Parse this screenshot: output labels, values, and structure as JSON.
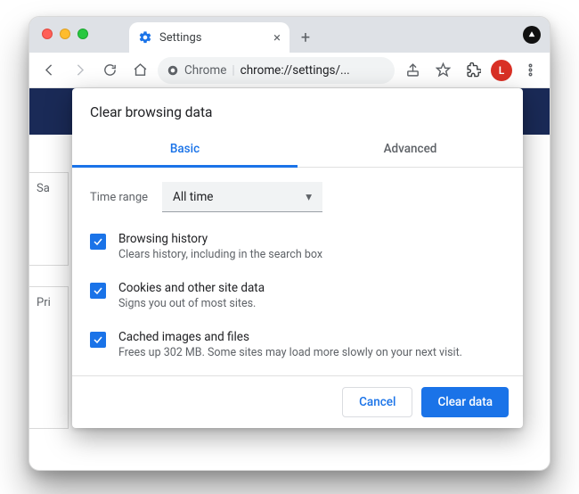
{
  "tab": {
    "title": "Settings"
  },
  "omnibox": {
    "label": "Chrome",
    "url": "chrome://settings/..."
  },
  "avatar_letter": "L",
  "bg": {
    "panel1": "Sa",
    "panel2": "Pri"
  },
  "dialog": {
    "title": "Clear browsing data",
    "tabs": {
      "basic": "Basic",
      "advanced": "Advanced"
    },
    "time_range_label": "Time range",
    "time_range_value": "All time",
    "items": [
      {
        "title": "Browsing history",
        "desc": "Clears history, including in the search box"
      },
      {
        "title": "Cookies and other site data",
        "desc": "Signs you out of most sites."
      },
      {
        "title": "Cached images and files",
        "desc": "Frees up 302 MB. Some sites may load more slowly on your next visit."
      }
    ],
    "cancel": "Cancel",
    "confirm": "Clear data"
  }
}
